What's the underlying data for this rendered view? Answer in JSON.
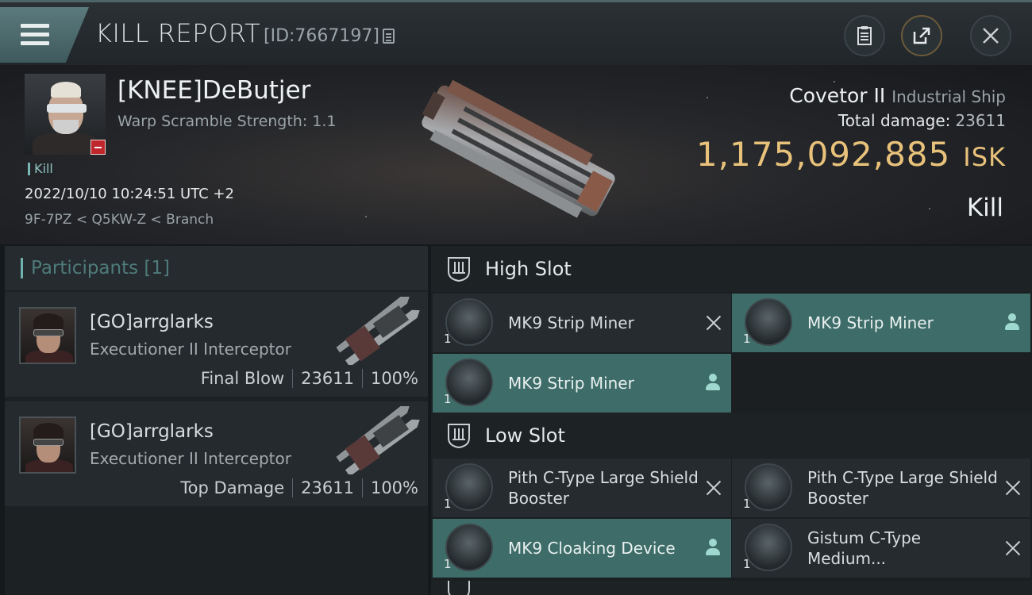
{
  "header": {
    "title": "KILL REPORT",
    "report_id": "[ID:7667197]",
    "icons": [
      "menu-icon",
      "copy-icon",
      "clipboard-icon",
      "share-icon",
      "close-icon"
    ]
  },
  "victim": {
    "name": "[KNEE]DeButjer",
    "warp_scramble": "Warp Scramble Strength: 1.1",
    "tag": "Kill",
    "datetime": "2022/10/10 10:24:51 UTC +2",
    "location": "9F-7PZ < Q5KW-Z < Branch"
  },
  "ship": {
    "name": "Covetor II",
    "class": "Industrial Ship",
    "total_damage_label": "Total damage:",
    "total_damage": "23611",
    "isk_value": "1,175,092,885",
    "isk_unit": "ISK",
    "result": "Kill"
  },
  "participants": {
    "title": "Participants [1]",
    "items": [
      {
        "name": "[GO]arrglarks",
        "ship": "Executioner II Interceptor",
        "role": "Final Blow",
        "damage": "23611",
        "percent": "100%"
      },
      {
        "name": "[GO]arrglarks",
        "ship": "Executioner II Interceptor",
        "role": "Top Damage",
        "damage": "23611",
        "percent": "100%"
      }
    ]
  },
  "fitting": {
    "high_slot": {
      "title": "High Slot",
      "modules": [
        {
          "name": "MK9 Strip Miner",
          "qty": "1",
          "status": "destroyed"
        },
        {
          "name": "MK9 Strip Miner",
          "qty": "1",
          "status": "dropped"
        },
        {
          "name": "MK9 Strip Miner",
          "qty": "1",
          "status": "dropped"
        }
      ]
    },
    "low_slot": {
      "title": "Low Slot",
      "modules": [
        {
          "name": "Pith C-Type Large Shield Booster",
          "qty": "1",
          "status": "destroyed"
        },
        {
          "name": "Pith C-Type Large Shield Booster",
          "qty": "1",
          "status": "destroyed"
        },
        {
          "name": "MK9 Cloaking Device",
          "qty": "1",
          "status": "dropped"
        },
        {
          "name": "Gistum C-Type Medium...",
          "qty": "1",
          "status": "destroyed"
        }
      ]
    }
  },
  "colors": {
    "accent_teal": "#3d6c69",
    "isk_gold": "#e8c27a",
    "loss_red": "#c0272d"
  }
}
